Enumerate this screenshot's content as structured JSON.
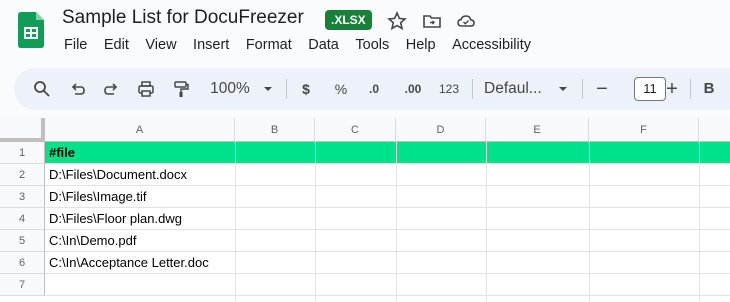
{
  "doc": {
    "title": "Sample List for DocuFreezer",
    "badge": ".XLSX"
  },
  "menu": [
    "File",
    "Edit",
    "View",
    "Insert",
    "Format",
    "Data",
    "Tools",
    "Help",
    "Accessibility"
  ],
  "toolbar": {
    "zoom": "100%",
    "currency": "$",
    "percent": "%",
    "dec_decrease": ".0",
    "dec_increase": ".00",
    "number_format": "123",
    "font": "Defaul...",
    "font_size": "11",
    "minus": "−",
    "plus": "+",
    "bold": "B"
  },
  "columns": [
    "A",
    "B",
    "C",
    "D",
    "E",
    "F"
  ],
  "rows": [
    {
      "num": "1",
      "a": "#file"
    },
    {
      "num": "2",
      "a": "D:\\Files\\Document.docx"
    },
    {
      "num": "3",
      "a": "D:\\Files\\Image.tif"
    },
    {
      "num": "4",
      "a": "D:\\Files\\Floor plan.dwg"
    },
    {
      "num": "5",
      "a": "C:\\In\\Demo.pdf"
    },
    {
      "num": "6",
      "a": "C:\\In\\Acceptance Letter.doc"
    },
    {
      "num": "7",
      "a": ""
    }
  ],
  "colors": {
    "header_row": "#00e28a",
    "brand": "#188038"
  }
}
